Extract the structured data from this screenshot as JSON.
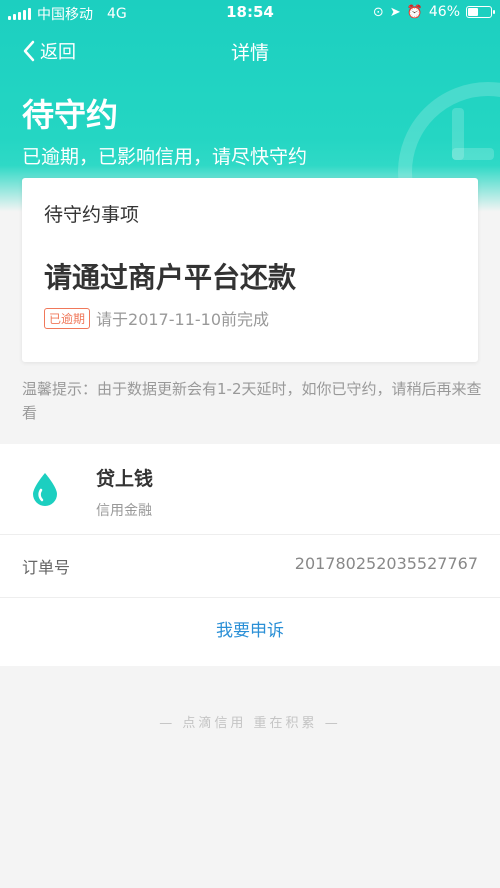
{
  "status_bar": {
    "carrier": "中国移动",
    "network": "4G",
    "time": "18:54",
    "battery": "46%",
    "battery_level": 0.46
  },
  "nav": {
    "back_label": "返回",
    "title": "详情"
  },
  "hero": {
    "title": "待守约",
    "subtitle": "已逾期，已影响信用，请尽快守约"
  },
  "card": {
    "header": "待守约事项",
    "main": "请通过商户平台还款",
    "badge": "已逾期",
    "due_text": "请于2017-11-10前完成"
  },
  "tip": "温馨提示：由于数据更新会有1-2天延时，如你已守约，请稍后再来查看",
  "merchant": {
    "name": "贷上钱",
    "type": "信用金融"
  },
  "order": {
    "label": "订单号",
    "value": "201780252035527767"
  },
  "appeal_label": "我要申诉",
  "footer": "— 点滴信用  重在积累 —",
  "colors": {
    "header": "#1ccfc0",
    "link": "#2a8fd6",
    "badge": "#f0785a"
  }
}
